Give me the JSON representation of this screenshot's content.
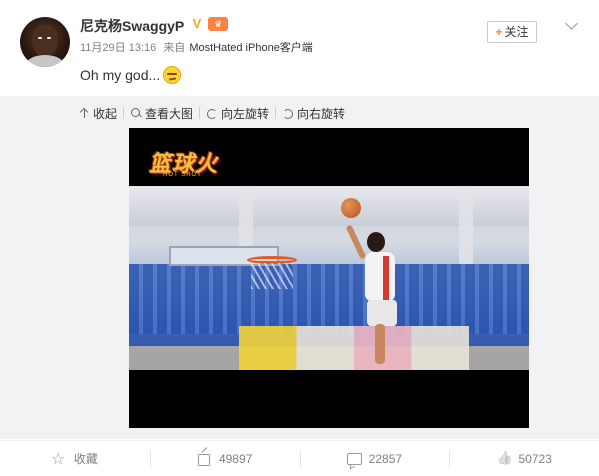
{
  "post": {
    "username": "尼克杨SwaggyP",
    "verified_icon": "verified-v-icon",
    "vip_icon": "vip-badge-icon",
    "date": "11月29日 13:16",
    "source_prefix": "来自",
    "source": "MostHated iPhone客户端",
    "text": "Oh my god...",
    "emoji": "smirk-emoji",
    "follow_label": "关注",
    "follow_plus": "+"
  },
  "media_tools": {
    "collapse": "收起",
    "view_large": "查看大图",
    "rotate_left": "向左旋转",
    "rotate_right": "向右旋转"
  },
  "video": {
    "channel_logo_text": "篮球火",
    "channel_logo_sub": "HOT SHOT"
  },
  "actions": {
    "favorite": "收藏",
    "repost_count": "49897",
    "comment_count": "22857",
    "like_count": "50723"
  },
  "colors": {
    "accent": "#ff8140",
    "verified": "#f5a623",
    "panel_bg": "#f2f2f5",
    "muted_text": "#808080"
  }
}
